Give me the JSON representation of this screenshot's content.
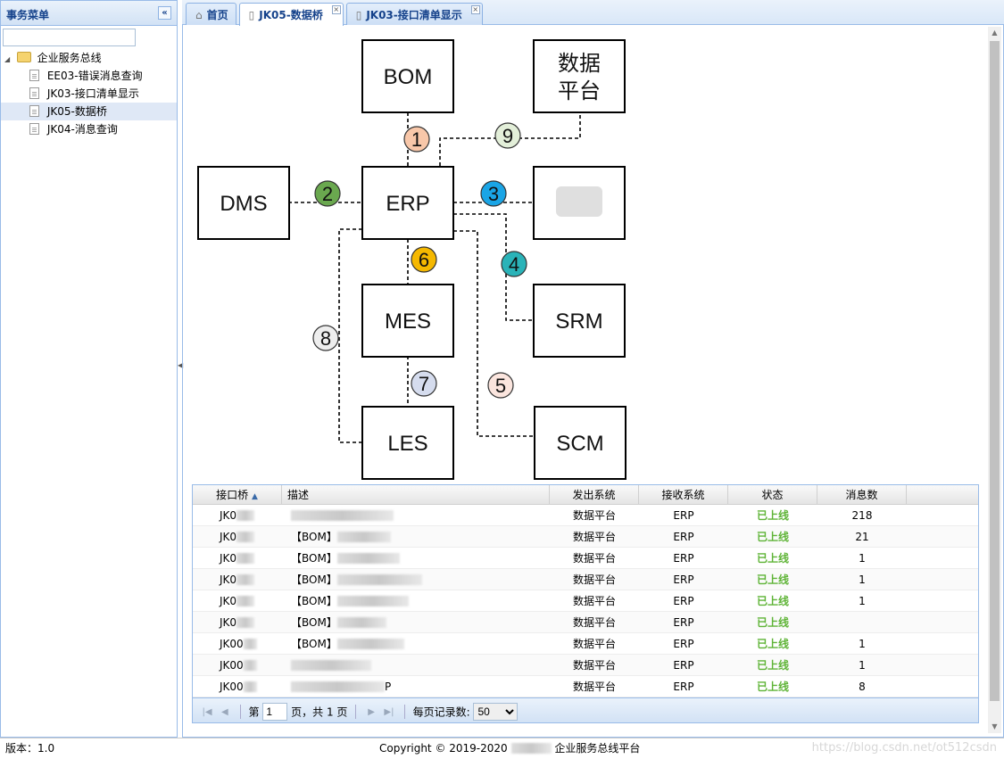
{
  "sidebar": {
    "title": "事务菜单",
    "collapse_icon": "«",
    "search_placeholder": "",
    "tree": {
      "root": "企业服务总线",
      "items": [
        {
          "label": "EE03-错误消息查询",
          "selected": false
        },
        {
          "label": "JK03-接口清单显示",
          "selected": false
        },
        {
          "label": "JK05-数据桥",
          "selected": true
        },
        {
          "label": "JK04-消息查询",
          "selected": false
        }
      ]
    }
  },
  "tabs": [
    {
      "label": "首页",
      "icon": "tag-icon",
      "active": false,
      "closable": false
    },
    {
      "label": "JK05-数据桥",
      "icon": "document-icon",
      "active": true,
      "closable": true
    },
    {
      "label": "JK03-接口清单显示",
      "icon": "document-icon",
      "active": false,
      "closable": true
    }
  ],
  "diagram": {
    "nodes": {
      "bom": "BOM",
      "data_platform_line1": "数据",
      "data_platform_line2": "平台",
      "dms": "DMS",
      "erp": "ERP",
      "mes": "MES",
      "srm": "SRM",
      "les": "LES",
      "scm": "SCM"
    },
    "badges": [
      {
        "num": "1",
        "color": "#f8c7a9"
      },
      {
        "num": "2",
        "color": "#6aa84f"
      },
      {
        "num": "3",
        "color": "#1aa5e6"
      },
      {
        "num": "4",
        "color": "#2ab3b8"
      },
      {
        "num": "5",
        "color": "#fbe5de"
      },
      {
        "num": "6",
        "color": "#f5b800"
      },
      {
        "num": "7",
        "color": "#d5dcee"
      },
      {
        "num": "8",
        "color": "#eeeeee"
      },
      {
        "num": "9",
        "color": "#e3efd9"
      }
    ]
  },
  "grid": {
    "columns": {
      "id": "接口桥",
      "desc": "描述",
      "src": "发出系统",
      "dst": "接收系统",
      "status": "状态",
      "count": "消息数"
    },
    "sort_icon": "sort-asc-icon",
    "rows": [
      {
        "id": "JK0",
        "desc": "",
        "src": "数据平台",
        "dst": "ERP",
        "status": "已上线",
        "count": "218"
      },
      {
        "id": "JK0",
        "desc": "【BOM】",
        "src": "数据平台",
        "dst": "ERP",
        "status": "已上线",
        "count": "21"
      },
      {
        "id": "JK0",
        "desc": "【BOM】",
        "src": "数据平台",
        "dst": "ERP",
        "status": "已上线",
        "count": "1"
      },
      {
        "id": "JK0",
        "desc": "【BOM】",
        "src": "数据平台",
        "dst": "ERP",
        "status": "已上线",
        "count": "1"
      },
      {
        "id": "JK0",
        "desc": "【BOM】",
        "src": "数据平台",
        "dst": "ERP",
        "status": "已上线",
        "count": "1"
      },
      {
        "id": "JK0",
        "desc": "【BOM】",
        "src": "数据平台",
        "dst": "ERP",
        "status": "已上线",
        "count": ""
      },
      {
        "id": "JK00",
        "desc": "【BOM】",
        "src": "数据平台",
        "dst": "ERP",
        "status": "已上线",
        "count": "1"
      },
      {
        "id": "JK00",
        "desc": "",
        "src": "数据平台",
        "dst": "ERP",
        "status": "已上线",
        "count": "1"
      },
      {
        "id": "JK00",
        "desc": "P",
        "src": "数据平台",
        "dst": "ERP",
        "status": "已上线",
        "count": "8"
      }
    ],
    "pager": {
      "page_prefix": "第",
      "page_value": "1",
      "page_suffix": "页，共 1 页",
      "page_size_label": "每页记录数:",
      "page_size_value": "50"
    }
  },
  "footer": {
    "version": "版本：1.0",
    "copyright_prefix": "Copyright © 2019-2020",
    "copyright_suffix": "企业服务总线平台",
    "watermark": "https://blog.csdn.net/ot512csdn"
  }
}
